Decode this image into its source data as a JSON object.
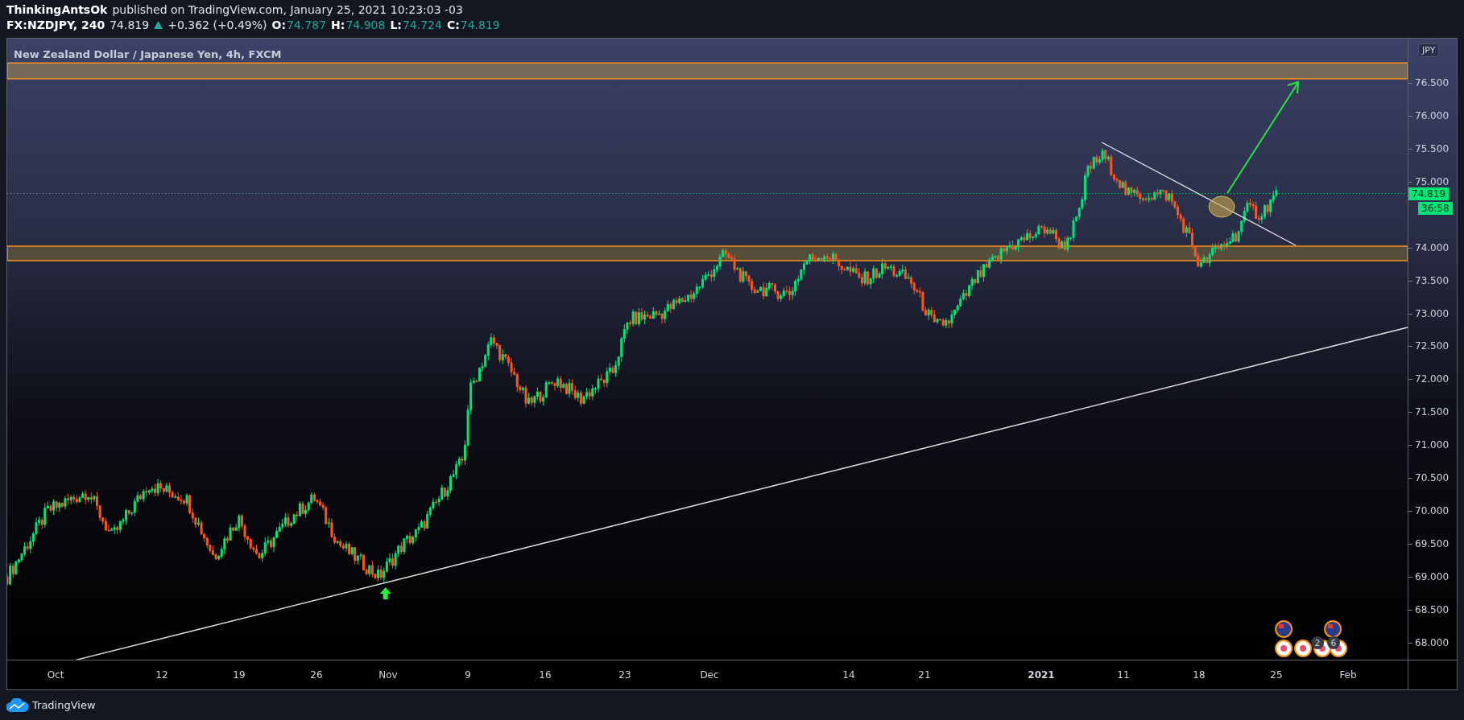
{
  "header": {
    "author": "ThinkingAntsOk",
    "published": "published on TradingView.com, January 25, 2021 10:23:03 -03"
  },
  "quote": {
    "symbol": "FX:NZDJPY, 240",
    "last": "74.819",
    "rising": true,
    "change": "+0.362 (+0.49%)",
    "ohlc": [
      {
        "label": "O:",
        "value": "74.787"
      },
      {
        "label": "H:",
        "value": "74.908"
      },
      {
        "label": "L:",
        "value": "74.724"
      },
      {
        "label": "C:",
        "value": "74.819"
      }
    ]
  },
  "chart": {
    "title": "New Zealand Dollar / Japanese Yen, 4h, FXCM",
    "currency": "JPY",
    "price_tag": "74.819",
    "countdown": "36:58",
    "event_badges": [
      "2",
      "6"
    ]
  },
  "price_axis": {
    "upper_labels": [
      "76.500",
      "76.000",
      "75.500",
      "75.000"
    ],
    "lower_labels": [
      "74.000",
      "73.500",
      "73.000",
      "72.500",
      "72.000",
      "71.500",
      "71.000",
      "70.500",
      "70.000",
      "69.500",
      "69.000",
      "68.500",
      "68.000"
    ]
  },
  "time_axis": {
    "labels": [
      {
        "text": "Oct",
        "kind": "month"
      },
      {
        "text": "12",
        "kind": "day"
      },
      {
        "text": "19",
        "kind": "day"
      },
      {
        "text": "26",
        "kind": "day"
      },
      {
        "text": "Nov",
        "kind": "month"
      },
      {
        "text": "9",
        "kind": "day"
      },
      {
        "text": "16",
        "kind": "day"
      },
      {
        "text": "23",
        "kind": "day"
      },
      {
        "text": "Dec",
        "kind": "month"
      },
      {
        "text": "14",
        "kind": "day"
      },
      {
        "text": "21",
        "kind": "day"
      },
      {
        "text": "2021",
        "kind": "year"
      },
      {
        "text": "11",
        "kind": "day"
      },
      {
        "text": "18",
        "kind": "day"
      },
      {
        "text": "25",
        "kind": "day"
      },
      {
        "text": "Feb",
        "kind": "month"
      }
    ]
  },
  "footer": {
    "brand": "TradingView"
  }
}
